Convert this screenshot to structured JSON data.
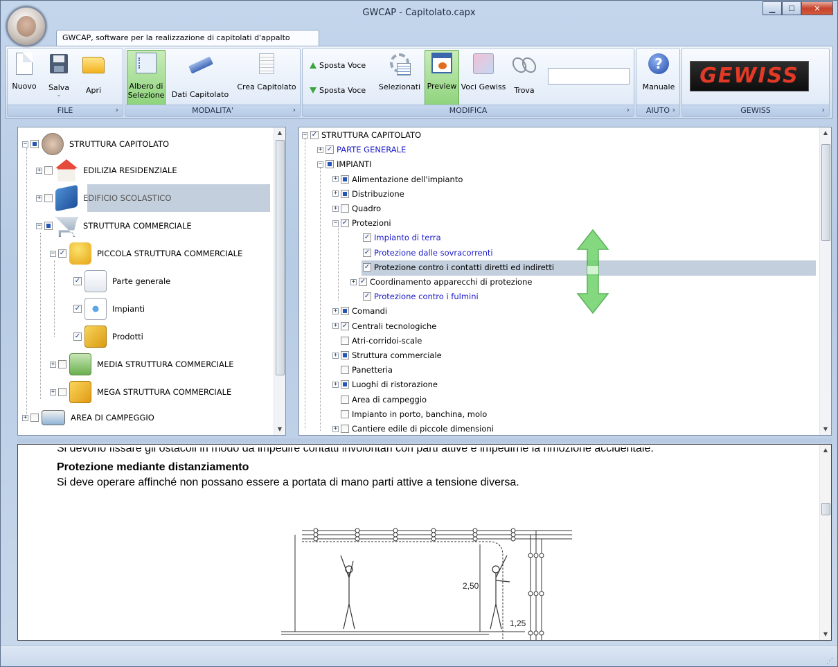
{
  "window": {
    "title": "GWCAP - Capitolato.capx"
  },
  "ribbon": {
    "tab_label": "GWCAP, software per la realizzazione di capitolati d'appalto",
    "groups": {
      "file": {
        "label": "FILE",
        "buttons": {
          "nuovo": "Nuovo",
          "salva": "Salva",
          "apri": "Apri"
        }
      },
      "modalita": {
        "label": "MODALITA'",
        "buttons": {
          "albero_l1": "Albero di",
          "albero_l2": "Selezione",
          "dati": "Dati Capitolato",
          "crea": "Crea Capitolato"
        }
      },
      "modifica": {
        "label": "MODIFICA",
        "buttons": {
          "sposta_su": "Sposta Voce",
          "sposta_giu": "Sposta Voce",
          "selezionati": "Selezionati",
          "preview": "Preview",
          "voci": "Voci Gewiss",
          "trova": "Trova"
        },
        "find_value": ""
      },
      "aiuto": {
        "label": "AIUTO",
        "buttons": {
          "manuale": "Manuale"
        }
      },
      "gewiss": {
        "label": "GEWISS",
        "logo_text": "GEWISS"
      }
    }
  },
  "left_tree": {
    "items": [
      {
        "label": "STRUTTURA CAPITOLATO",
        "check": "partial",
        "expander": "−"
      },
      {
        "label": "EDILIZIA RESIDENZIALE",
        "check": "none",
        "expander": "+"
      },
      {
        "label": "EDIFICIO SCOLASTICO",
        "check": "none",
        "expander": "+"
      },
      {
        "label": "STRUTTURA COMMERCIALE",
        "check": "partial",
        "expander": "−"
      },
      {
        "label": "PICCOLA STRUTTURA COMMERCIALE",
        "check": "checked",
        "expander": "−"
      },
      {
        "label": "Parte generale",
        "check": "checked"
      },
      {
        "label": "Impianti",
        "check": "checked"
      },
      {
        "label": "Prodotti",
        "check": "checked"
      },
      {
        "label": "MEDIA STRUTTURA COMMERCIALE",
        "check": "none",
        "expander": "+"
      },
      {
        "label": "MEGA STRUTTURA COMMERCIALE",
        "check": "none",
        "expander": "+"
      },
      {
        "label": "AREA DI CAMPEGGIO",
        "check": "none",
        "expander": "+"
      }
    ]
  },
  "right_tree": {
    "items": [
      {
        "label": "STRUTTURA CAPITOLATO",
        "check": "checked",
        "expander": "−"
      },
      {
        "label": "PARTE GENERALE",
        "check": "checked",
        "expander": "+"
      },
      {
        "label": "IMPIANTI",
        "check": "partial",
        "expander": "−"
      },
      {
        "label": "Alimentazione dell'impianto",
        "check": "partial",
        "expander": "+"
      },
      {
        "label": "Distribuzione",
        "check": "partial",
        "expander": "+"
      },
      {
        "label": "Quadro",
        "check": "none",
        "expander": "+"
      },
      {
        "label": "Protezioni",
        "check": "checked",
        "expander": "−"
      },
      {
        "label": "Impianto di terra",
        "check": "checked"
      },
      {
        "label": "Protezione dalle sovracorrenti",
        "check": "checked"
      },
      {
        "label": "Protezione contro i contatti diretti ed indiretti",
        "check": "checked"
      },
      {
        "label": "Coordinamento apparecchi di protezione",
        "check": "checked",
        "expander": "+"
      },
      {
        "label": "Protezione contro i fulmini",
        "check": "checked"
      },
      {
        "label": "Comandi",
        "check": "partial",
        "expander": "+"
      },
      {
        "label": "Centrali tecnologiche",
        "check": "checked",
        "expander": "+"
      },
      {
        "label": "Atri-corridoi-scale",
        "check": "none"
      },
      {
        "label": "Struttura commerciale",
        "check": "partial",
        "expander": "+"
      },
      {
        "label": "Panetteria",
        "check": "none"
      },
      {
        "label": "Luoghi di ristorazione",
        "check": "partial",
        "expander": "+"
      },
      {
        "label": "Area di campeggio",
        "check": "none"
      },
      {
        "label": "Impianto in porto, banchina, molo",
        "check": "none"
      },
      {
        "label": "Cantiere edile di piccole dimensioni",
        "check": "none",
        "expander": "+"
      }
    ]
  },
  "preview": {
    "cut_line": "Si devono fissare gli ostacoli in modo da impedire contatti involontari con parti attive e impedirne la rimozione accidentale.",
    "heading": "Protezione mediante distanziamento",
    "body": "Si deve operare affinché non possano essere a portata di mano parti attive a tensione diversa.",
    "figure_labels": {
      "height": "2,50",
      "width": "1,25"
    }
  }
}
